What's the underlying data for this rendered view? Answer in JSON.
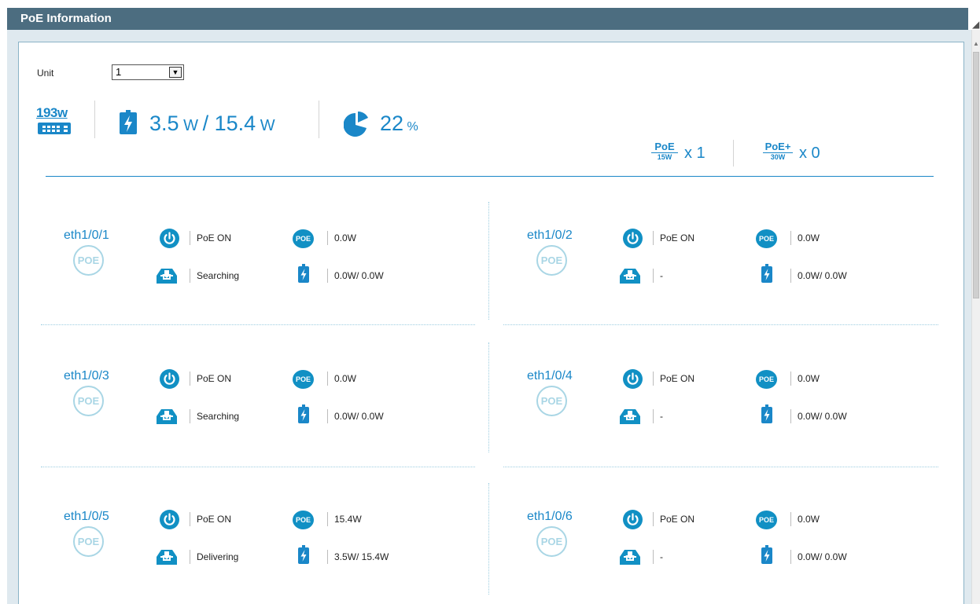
{
  "title": "PoE Information",
  "unit": {
    "label": "Unit",
    "value": "1"
  },
  "summary": {
    "budget_value": "193w",
    "power_used": "3.5",
    "power_unit": "W",
    "power_separator": "/",
    "power_total": "15.4",
    "usage_percent": "22",
    "percent_sign": "%",
    "poe_class": {
      "top": "PoE",
      "bottom": "15W",
      "count": "x 1"
    },
    "poeplus_class": {
      "top": "PoE+",
      "bottom": "30W",
      "count": "x 0"
    }
  },
  "ring_label": "POE",
  "poe_badge": "POE",
  "ports": [
    {
      "name": "eth1/0/1",
      "status": "PoE ON",
      "detect": "Searching",
      "class_power": "0.0W",
      "usage": "0.0W/ 0.0W"
    },
    {
      "name": "eth1/0/2",
      "status": "PoE ON",
      "detect": "-",
      "class_power": "0.0W",
      "usage": "0.0W/ 0.0W"
    },
    {
      "name": "eth1/0/3",
      "status": "PoE ON",
      "detect": "Searching",
      "class_power": "0.0W",
      "usage": "0.0W/ 0.0W"
    },
    {
      "name": "eth1/0/4",
      "status": "PoE ON",
      "detect": "-",
      "class_power": "0.0W",
      "usage": "0.0W/ 0.0W"
    },
    {
      "name": "eth1/0/5",
      "status": "PoE ON",
      "detect": "Delivering",
      "class_power": "15.4W",
      "usage": "3.5W/ 15.4W"
    },
    {
      "name": "eth1/0/6",
      "status": "PoE ON",
      "detect": "-",
      "class_power": "0.0W",
      "usage": "0.0W/ 0.0W"
    }
  ],
  "colors": {
    "accent": "#1a87c8",
    "titlebar": "#4c6d80",
    "ring": "#a9d6e5"
  },
  "icons": [
    "power-icon",
    "download-icon",
    "poe-icon",
    "battery-icon",
    "pie-icon",
    "budget-icon"
  ]
}
